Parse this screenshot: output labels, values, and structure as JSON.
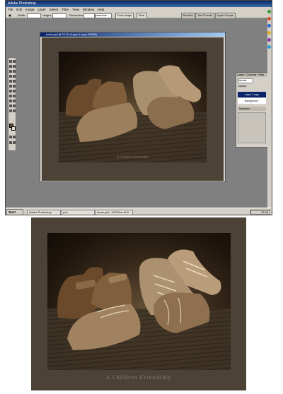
{
  "window": {
    "app_title": "Adobe Photoshop",
    "doc_title": "boots.psd @ 33.3% (Layer 1 copy, RGB/8)"
  },
  "menu": [
    "File",
    "Edit",
    "Image",
    "Layer",
    "Select",
    "Filter",
    "View",
    "Window",
    "Help"
  ],
  "options": {
    "width_label": "Width:",
    "height_label": "Height:",
    "resolution_label": "Resolution:",
    "resolution_units": "pixels/inch",
    "front_image_button": "Front Image",
    "clear_button": "Clear"
  },
  "palette_well": [
    "Brushes",
    "Tool Presets",
    "Layer Comps"
  ],
  "layers_panel": {
    "tabs": [
      "Layers",
      "Channels",
      "Paths"
    ],
    "blend_mode": "Normal",
    "opacity_label": "Opacity:",
    "layers": [
      "Layer 1 copy",
      "Background"
    ],
    "navigator_tab": "Navigator"
  },
  "taskbar": {
    "start": "Start",
    "tasks": [
      "Adobe Photoshop",
      "psd",
      "boots.psd - ACDSee v5.0"
    ],
    "clock": "12:00"
  },
  "photo": {
    "caption": "A     Children     Friendship"
  },
  "colors": {
    "frame": "#4c4236",
    "photoshop_bg": "#808080",
    "titlebar": "#0a246a",
    "caption": "#8b7f6c"
  }
}
